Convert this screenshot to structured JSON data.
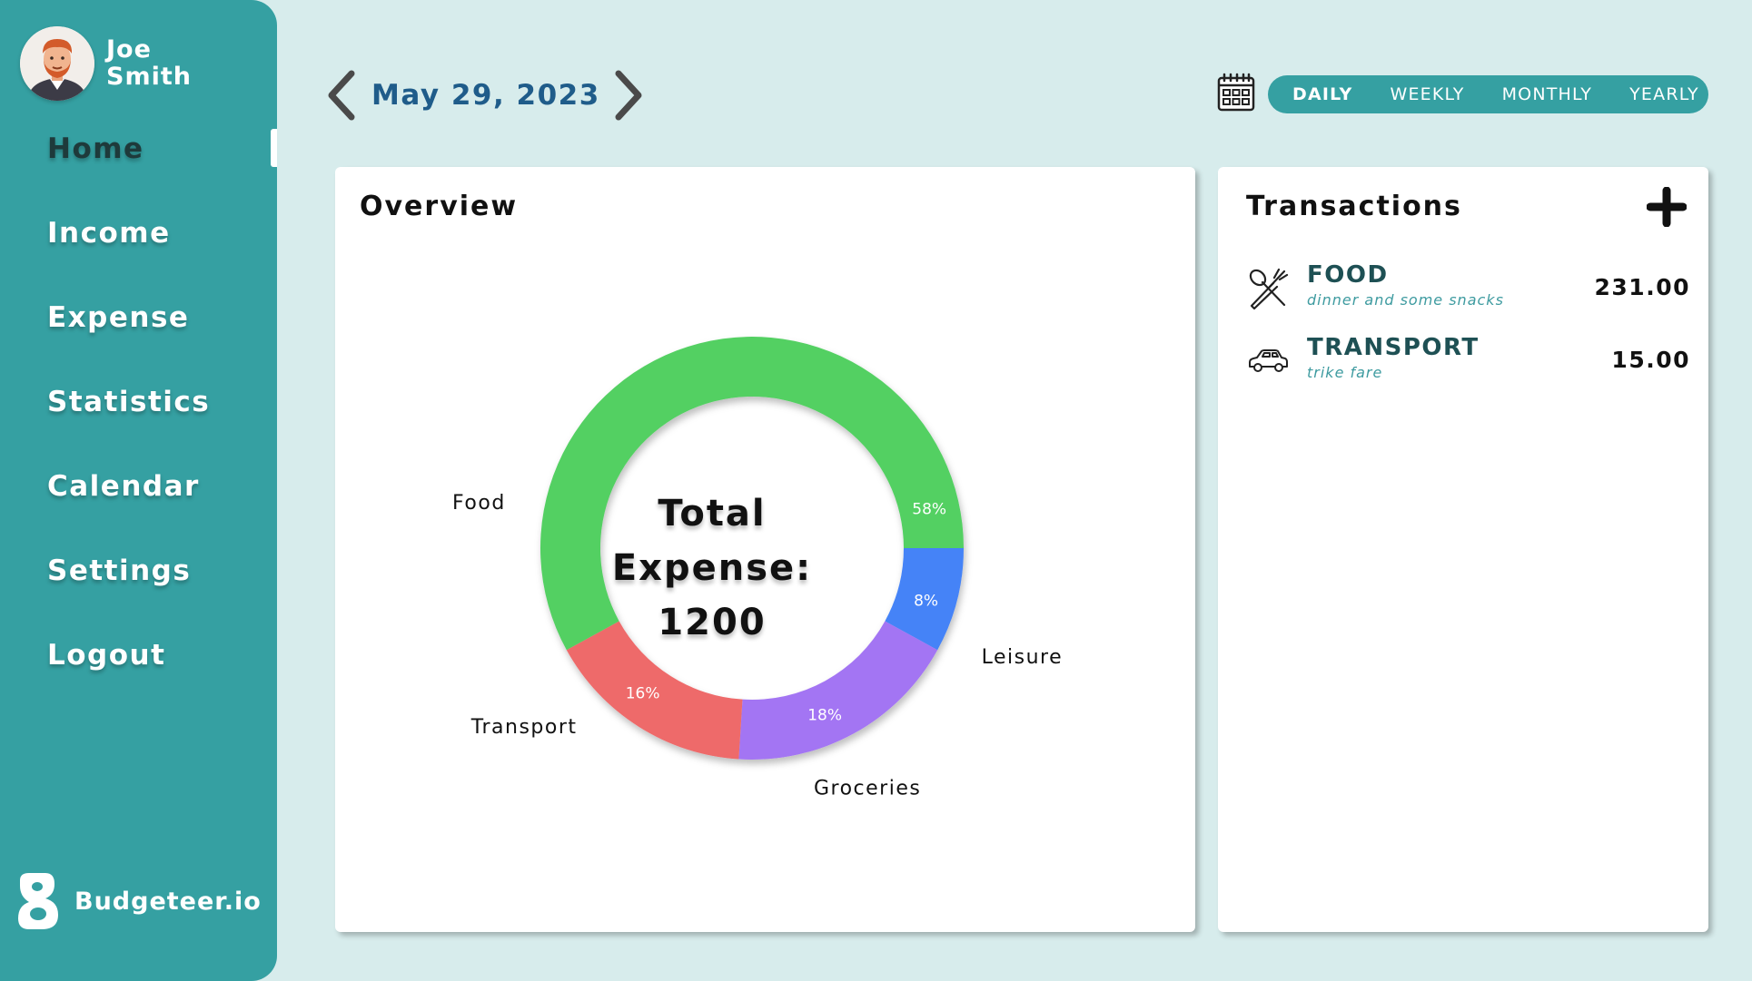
{
  "user": {
    "first_name": "Joe",
    "last_name": "Smith"
  },
  "nav": {
    "items": [
      {
        "label": "Home",
        "active": true
      },
      {
        "label": "Income"
      },
      {
        "label": "Expense"
      },
      {
        "label": "Statistics"
      },
      {
        "label": "Calendar"
      },
      {
        "label": "Settings"
      },
      {
        "label": "Logout"
      }
    ]
  },
  "brand": {
    "name": "Budgeteer.io"
  },
  "date_nav": {
    "date": "May 29, 2023"
  },
  "period": {
    "tabs": [
      "DAILY",
      "WEEKLY",
      "MONTHLY",
      "YEARLY"
    ],
    "selected": "DAILY"
  },
  "overview": {
    "title": "Overview",
    "center_label": [
      "Total",
      "Expense:",
      "1200"
    ]
  },
  "chart_data": {
    "type": "pie",
    "title": "",
    "categories": [
      "Leisure",
      "Groceries",
      "Transport",
      "Food"
    ],
    "values": [
      8,
      18,
      16,
      58
    ],
    "value_labels": [
      "8%",
      "18%",
      "16%",
      "58%"
    ],
    "colors": [
      "#4583f7",
      "#a374f3",
      "#ee6a6b",
      "#53d062"
    ]
  },
  "transactions": {
    "title": "Transactions",
    "items": [
      {
        "category": "FOOD",
        "note": "dinner and some snacks",
        "amount": "231.00",
        "icon": "fork-knife-icon"
      },
      {
        "category": "TRANSPORT",
        "note": "trike fare",
        "amount": "15.00",
        "icon": "car-icon"
      }
    ]
  },
  "colors": {
    "background": "#d7ecec",
    "sidebar": "#35a0a2",
    "date_text": "#1f5c8a",
    "tx_category": "#1e5054",
    "tx_note": "#3e9ba0"
  }
}
